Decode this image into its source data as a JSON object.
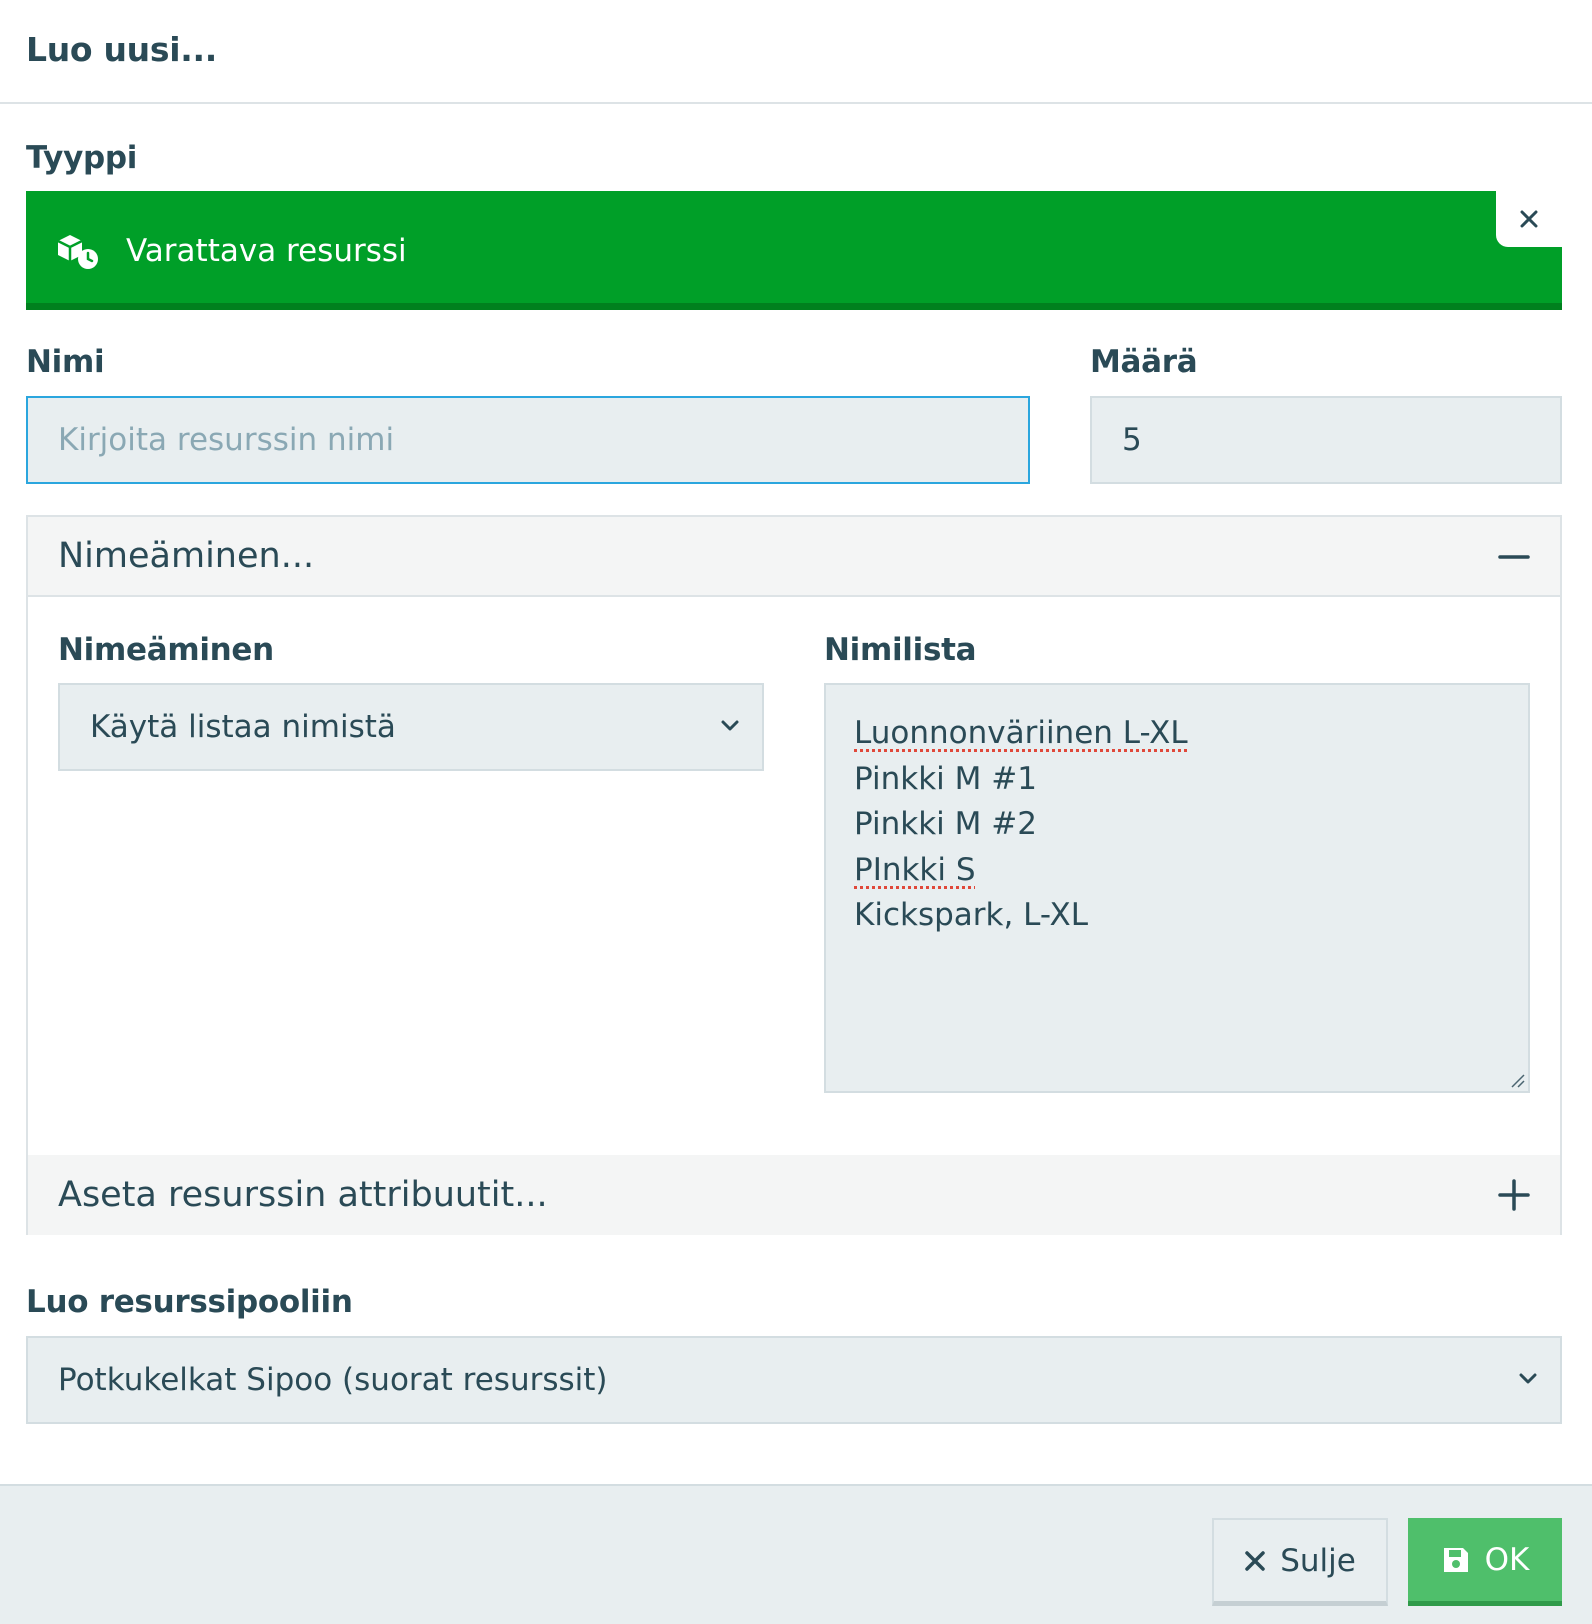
{
  "dialog": {
    "title": "Luo uusi..."
  },
  "type": {
    "label": "Tyyppi",
    "value": "Varattava resurssi",
    "icon": "resource-clock-icon",
    "close_icon": "close-icon",
    "bar_color": "#009f28"
  },
  "name": {
    "label": "Nimi",
    "placeholder": "Kirjoita resurssin nimi",
    "value": ""
  },
  "quantity": {
    "label": "Määrä",
    "value": "5"
  },
  "naming_section": {
    "header": "Nimeäminen...",
    "toggle_icon": "minus-icon",
    "naming_label": "Nimeäminen",
    "naming_selected": "Käytä listaa nimistä",
    "namelist_label": "Nimilista",
    "namelist": [
      "Luonnonväriinen L-XL",
      "Pinkki M #1",
      "Pinkki M #2",
      "PInkki S",
      "Kickspark, L-XL"
    ]
  },
  "attributes_section": {
    "header": "Aseta resurssin attribuutit...",
    "toggle_icon": "plus-icon"
  },
  "pool": {
    "label": "Luo resurssipooliin",
    "selected": "Potkukelkat Sipoo (suorat resurssit)"
  },
  "footer": {
    "close_label": "Sulje",
    "ok_label": "OK",
    "ok_color": "#4fbf6b"
  }
}
